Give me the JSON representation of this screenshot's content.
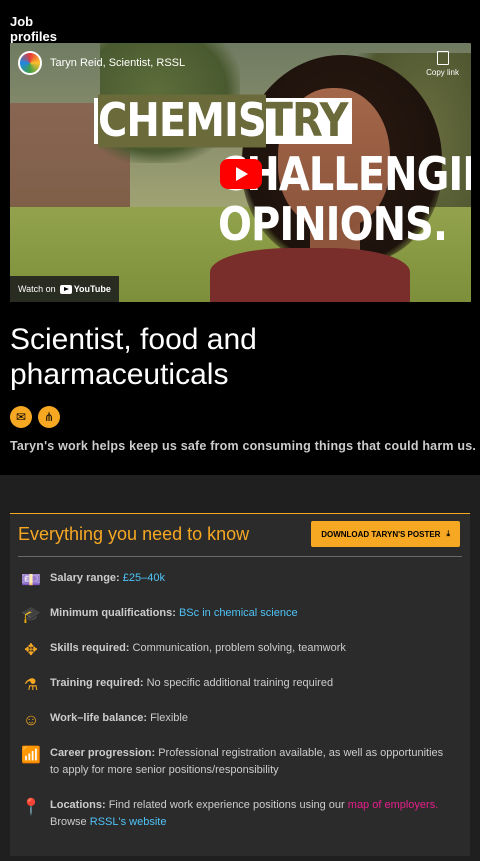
{
  "section_label": "Job profiles",
  "video": {
    "channel_title": "Taryn Reid, Scientist, RSSL",
    "copy_label": "Copy link",
    "watch_on": "Watch on",
    "youtube": "YouTube",
    "overlay_line1_a": "CHEMIS",
    "overlay_line1_b": "TRY",
    "overlay_line2": "CHALLENGING",
    "overlay_line3": "OPINIONS."
  },
  "title": "Scientist, food and pharmaceuticals",
  "lede": "Taryn's work helps keep us safe from consuming things that could harm us.",
  "panel": {
    "heading": "Everything you need to know",
    "download_label": "DOWNLOAD TARYN'S POSTER",
    "salary_label": "Salary range:",
    "salary_value": "£25–40k",
    "qual_label": "Minimum qualifications:",
    "qual_value": "BSc in chemical science",
    "skills_label": "Skills required:",
    "skills_value": "Communication, problem solving, teamwork",
    "training_label": "Training required:",
    "training_value": "No specific additional training required",
    "wlb_label": "Work–life balance:",
    "wlb_value": "Flexible",
    "career_label": "Career progression:",
    "career_value": "Professional registration available, as well as opportunities to apply for more senior positions/responsibility",
    "loc_label": "Locations:",
    "loc_value": "Find related work experience positions using our",
    "loc_link": "map of employers.",
    "loc_browse": "Browse",
    "loc_link2": "RSSL's website"
  }
}
